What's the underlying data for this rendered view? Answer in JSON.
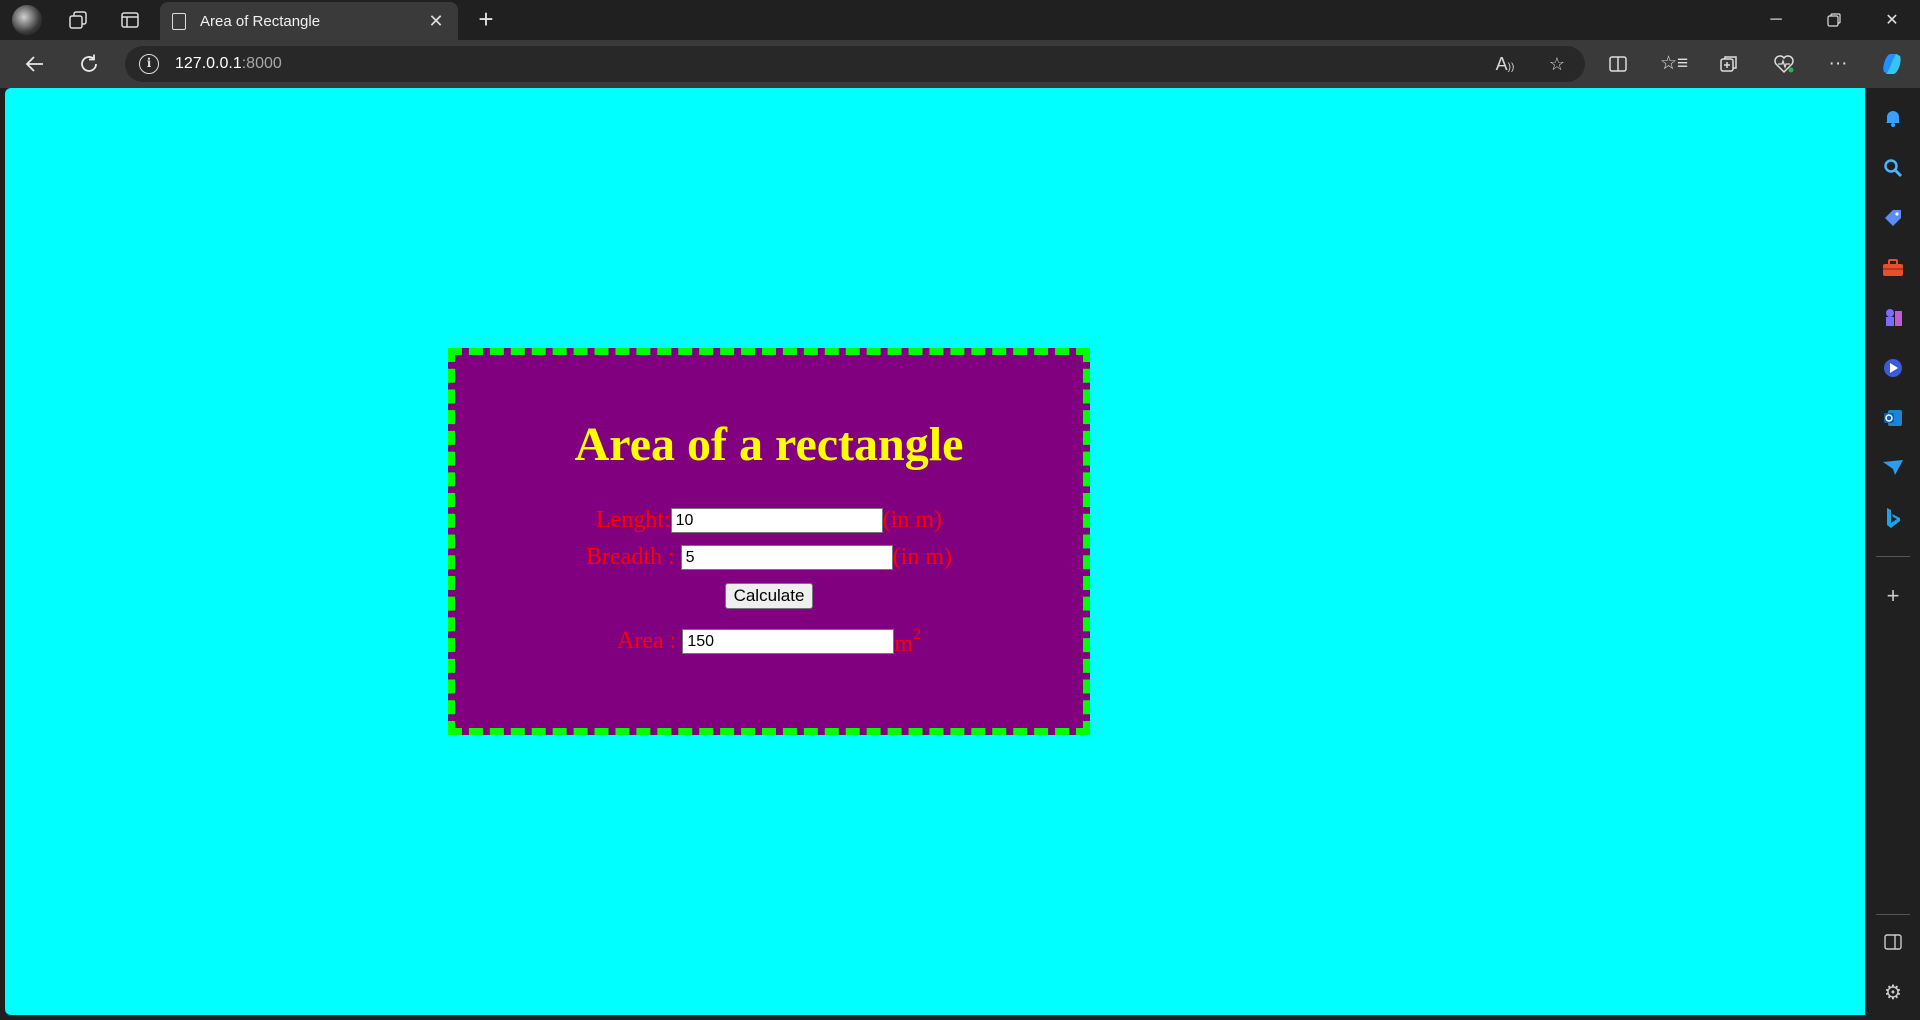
{
  "browser": {
    "tab_title": "Area of Rectangle",
    "url_host": "127.0.0.1",
    "url_port": ":8000",
    "new_tab_glyph": "+",
    "accent_color": "#3a3a3a"
  },
  "page": {
    "background_color": "#00ffff",
    "card_color": "#800080",
    "card_border_color": "#00ff00",
    "heading": "Area of a rectangle",
    "length": {
      "label": "Lenght:",
      "value": "10",
      "unit": "(in m)"
    },
    "breadth": {
      "label": "Breadth :",
      "value": "5",
      "unit": "(in m)"
    },
    "calculate_label": "Calculate",
    "area": {
      "label": "Area :",
      "value": "150",
      "unit_base": "m",
      "unit_exp": "2"
    }
  },
  "sidebar": {
    "icons": [
      "bell-icon",
      "search-icon",
      "tag-icon",
      "toolbox-icon",
      "chess-icon",
      "copilot-icon",
      "outlook-icon",
      "send-icon",
      "bing-icon",
      "add-icon",
      "panel-icon",
      "settings-icon"
    ]
  }
}
